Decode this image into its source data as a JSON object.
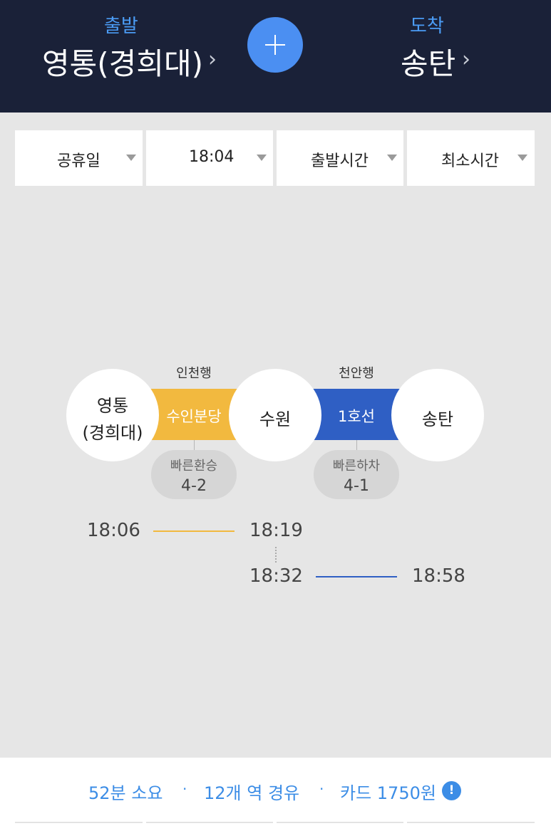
{
  "header": {
    "departure_label": "출발",
    "departure_station": "영통(경희대)",
    "arrival_label": "도착",
    "arrival_station": "송탄",
    "chevron": "›"
  },
  "filters": [
    {
      "label": "공휴일"
    },
    {
      "label": "18:04"
    },
    {
      "label": "출발시간"
    },
    {
      "label": "최소시간"
    }
  ],
  "route": {
    "colors": {
      "suin_bundang": "#f2b93f",
      "line1": "#2f5fc4"
    },
    "stations": {
      "start_line1": "영통",
      "start_line2": "(경희대)",
      "transfer": "수원",
      "end": "송탄"
    },
    "segments": [
      {
        "line": "수인분당",
        "direction": "인천행",
        "tip_title": "빠른환승",
        "tip_value": "4-2"
      },
      {
        "line": "1호선",
        "direction": "천안행",
        "tip_title": "빠른하차",
        "tip_value": "4-1"
      }
    ],
    "times": {
      "seg1_depart": "18:06",
      "seg1_arrive": "18:19",
      "seg2_depart": "18:32",
      "seg2_arrive": "18:58"
    }
  },
  "summary": {
    "duration": "52분 소요",
    "separator": "·",
    "stations": "12개 역 경유",
    "fare": "카드 1750원",
    "info_icon": "!"
  }
}
